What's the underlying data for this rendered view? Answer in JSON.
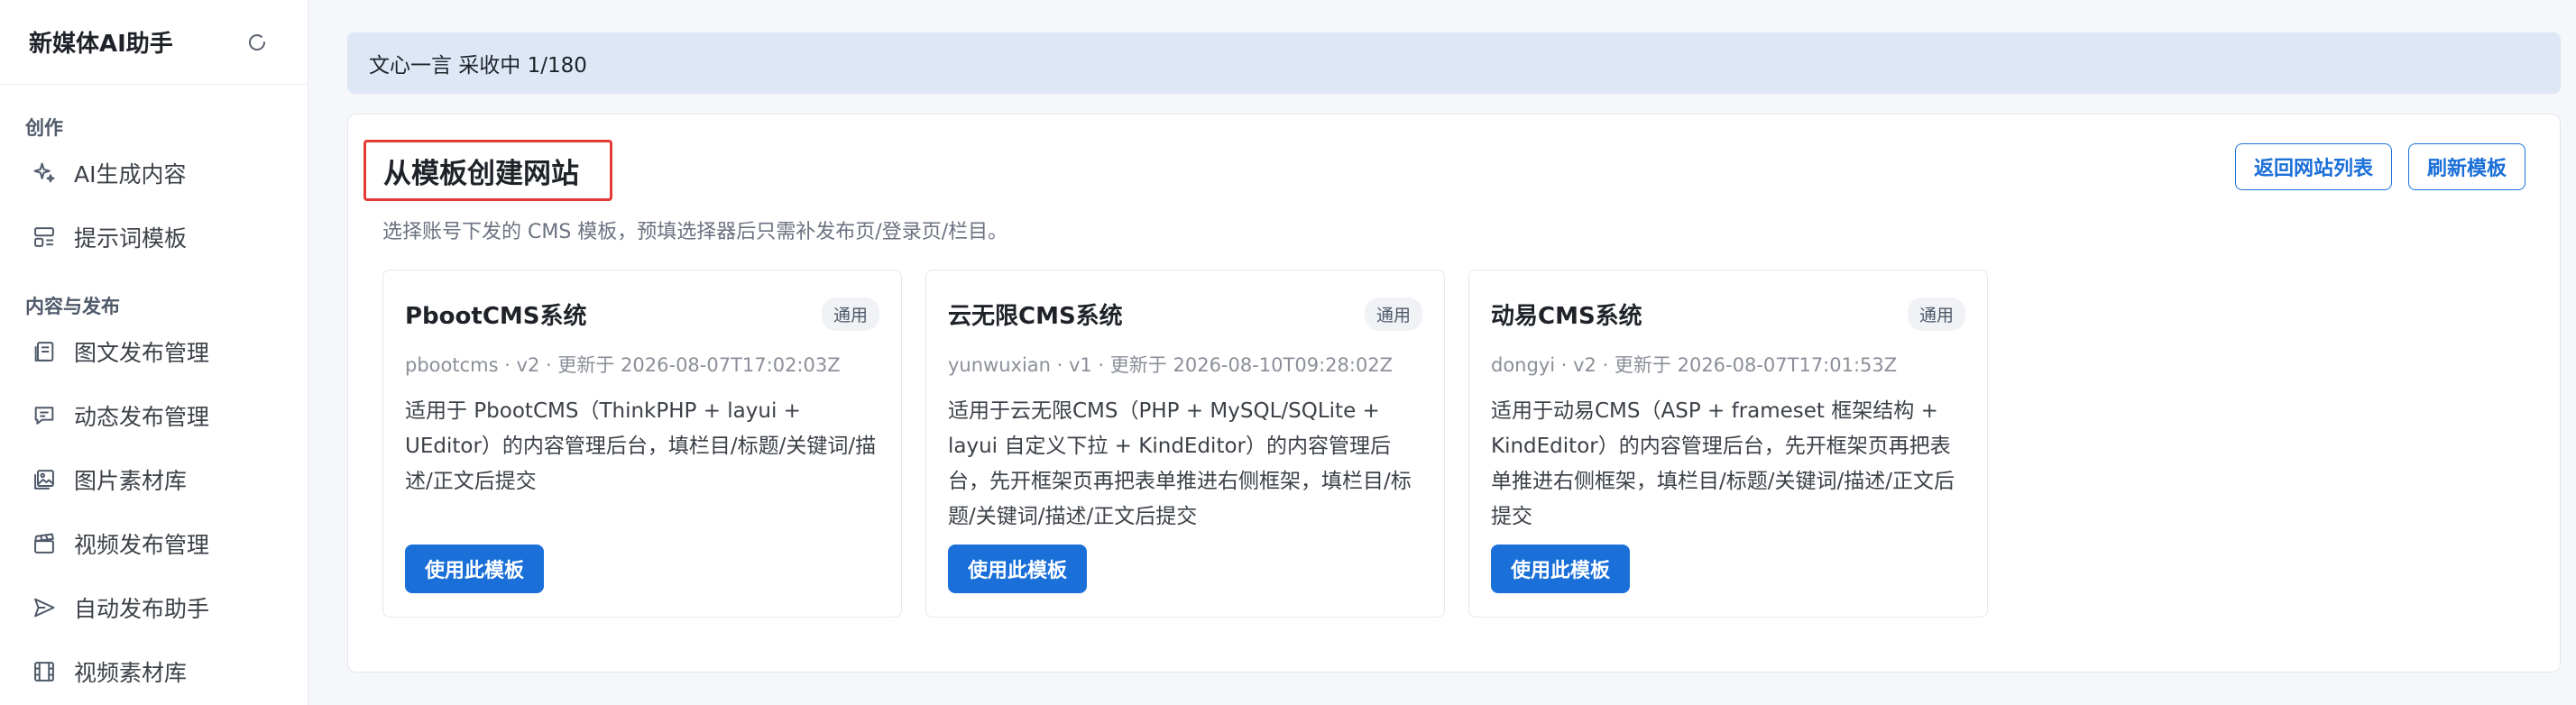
{
  "app": {
    "title": "新媒体AI助手",
    "refresh_icon": "refresh-icon"
  },
  "sidebar": {
    "sections": [
      {
        "label": "创作",
        "items": [
          {
            "label": "AI生成内容",
            "icon": "sparkle-icon"
          },
          {
            "label": "提示词模板",
            "icon": "template-icon"
          }
        ]
      },
      {
        "label": "内容与发布",
        "items": [
          {
            "label": "图文发布管理",
            "icon": "article-icon"
          },
          {
            "label": "动态发布管理",
            "icon": "message-icon"
          },
          {
            "label": "图片素材库",
            "icon": "image-icon"
          },
          {
            "label": "视频发布管理",
            "icon": "clapper-icon"
          },
          {
            "label": "自动发布助手",
            "icon": "send-icon"
          },
          {
            "label": "视频素材库",
            "icon": "film-icon"
          }
        ]
      }
    ]
  },
  "status": {
    "text": "文心一言 采收中 1/180"
  },
  "panel": {
    "title": "从模板创建网站",
    "subtitle": "选择账号下发的 CMS 模板，预填选择器后只需补发布页/登录页/栏目。",
    "actions": {
      "back_label": "返回网站列表",
      "refresh_label": "刷新模板"
    },
    "cards": [
      {
        "name": "PbootCMS系统",
        "tag": "通用",
        "meta": "pbootcms · v2 · 更新于 2026-08-07T17:02:03Z",
        "desc": "适用于 PbootCMS（ThinkPHP + layui + UEditor）的内容管理后台，填栏目/标题/关键词/描述/正文后提交",
        "button": "使用此模板"
      },
      {
        "name": "云无限CMS系统",
        "tag": "通用",
        "meta": "yunwuxian · v1 · 更新于 2026-08-10T09:28:02Z",
        "desc": "适用于云无限CMS（PHP + MySQL/SQLite + layui 自定义下拉 + KindEditor）的内容管理后台，先开框架页再把表单推进右侧框架，填栏目/标题/关键词/描述/正文后提交",
        "button": "使用此模板"
      },
      {
        "name": "动易CMS系统",
        "tag": "通用",
        "meta": "dongyi · v2 · 更新于 2026-08-07T17:01:53Z",
        "desc": "适用于动易CMS（ASP + frameset 框架结构 + KindEditor）的内容管理后台，先开框架页再把表单推进右侧框架，填栏目/标题/关键词/描述/正文后提交",
        "button": "使用此模板"
      }
    ]
  },
  "colors": {
    "accent": "#1a6fd8",
    "status_bg": "#dde7f6",
    "highlight_border": "#e53935"
  }
}
